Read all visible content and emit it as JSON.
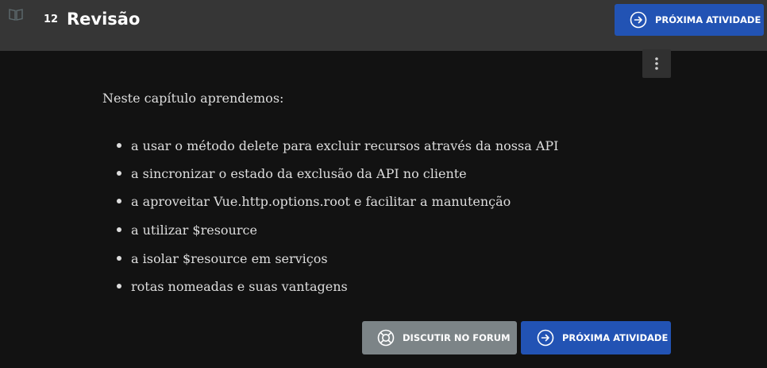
{
  "header": {
    "chapter_number": "12",
    "title": "Revisão",
    "next_button_label": "PRÓXIMA ATIVIDADE"
  },
  "content": {
    "intro": "Neste capítulo aprendemos:",
    "items": [
      "a usar o método delete para excluir recursos através da nossa API",
      "a sincronizar o estado da exclusão da API no cliente",
      "a aproveitar Vue.http.options.root e facilitar a manutenção",
      "a utilizar $resource",
      "a isolar $resource em serviços",
      "rotas nomeadas e suas vantagens"
    ]
  },
  "footer": {
    "forum_button_label": "DISCUTIR NO FORUM",
    "next_button_label": "PRÓXIMA ATIVIDADE"
  },
  "colors": {
    "topbar": "#363636",
    "background": "#121212",
    "primary_button": "#2253b4",
    "secondary_button": "#7c8487"
  },
  "icons": {
    "logo": "book-icon",
    "next": "arrow-right-circle-icon",
    "forum": "lifebuoy-icon",
    "menu": "more-vertical-icon"
  }
}
